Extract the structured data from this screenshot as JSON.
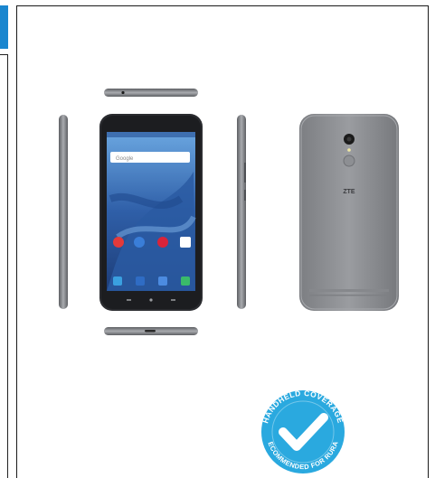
{
  "product_image": {
    "subject": "phone-front-back-side-views"
  },
  "badge": {
    "text_top": "HANDHELD COVERAGE",
    "text_bottom": "RECOMMENDED FOR RURAL",
    "color": "#2aa9df"
  },
  "phone_screen": {
    "search_hint": "Google",
    "brand_mark": "ZTE"
  },
  "colors": {
    "accent": "#1a86cf",
    "phone_body": "#8a8c90",
    "screen_blue": "#2f5fa8"
  }
}
